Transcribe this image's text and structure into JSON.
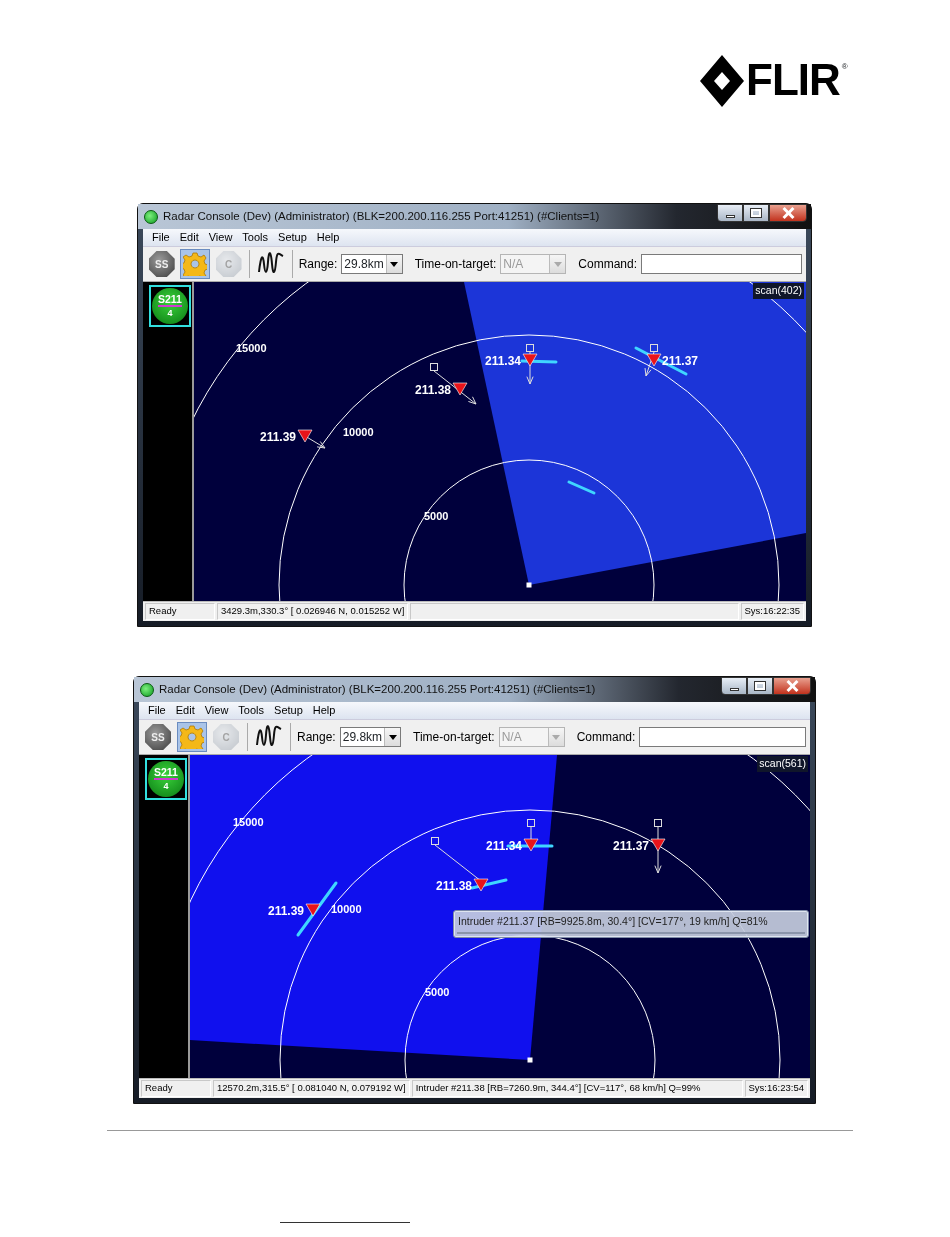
{
  "logo": {
    "text": "FLIR",
    "mark": "®"
  },
  "windows": [
    {
      "title": "Radar Console (Dev) (Administrator) (BLK=200.200.116.255 Port:41251) (#Clients=1)",
      "menu": [
        "File",
        "Edit",
        "View",
        "Tools",
        "Setup",
        "Help"
      ],
      "toolbar": {
        "buttons": [
          {
            "kind": "octagon",
            "label": "SS",
            "selected": false,
            "disabled": false
          },
          {
            "kind": "gear",
            "selected": true,
            "disabled": false
          },
          {
            "kind": "octagon",
            "label": "C",
            "selected": false,
            "disabled": true
          },
          {
            "kind": "wave",
            "selected": false,
            "disabled": false
          }
        ],
        "range": {
          "label": "Range:",
          "value": "29.8km"
        },
        "time_on_target": {
          "label": "Time-on-target:",
          "value": "N/A",
          "disabled": true
        },
        "command": {
          "label": "Command:"
        }
      },
      "sensors": [
        {
          "name": "S211",
          "count": "4",
          "selected": true
        }
      ],
      "radar": {
        "scan": "scan(402)",
        "rings": [
          "5000",
          "10000",
          "15000"
        ],
        "targets": [
          {
            "label": "211.34"
          },
          {
            "label": "211.37"
          },
          {
            "label": "211.38"
          },
          {
            "label": "211.39"
          }
        ]
      },
      "status_bar": {
        "state": "Ready",
        "position": "3429.3m,330.3° [ 0.026946 N,  0.015252 W]",
        "clock": "Sys:16:22:35"
      }
    },
    {
      "title": "Radar Console (Dev) (Administrator) (BLK=200.200.116.255 Port:41251) (#Clients=1)",
      "menu": [
        "File",
        "Edit",
        "View",
        "Tools",
        "Setup",
        "Help"
      ],
      "toolbar": {
        "buttons": [
          {
            "kind": "octagon",
            "label": "SS",
            "selected": false,
            "disabled": false
          },
          {
            "kind": "gear",
            "selected": true,
            "disabled": false
          },
          {
            "kind": "octagon",
            "label": "C",
            "selected": false,
            "disabled": true
          },
          {
            "kind": "wave",
            "selected": false,
            "disabled": false
          }
        ],
        "range": {
          "label": "Range:",
          "value": "29.8km"
        },
        "time_on_target": {
          "label": "Time-on-target:",
          "value": "N/A",
          "disabled": true
        },
        "command": {
          "label": "Command:"
        }
      },
      "sensors": [
        {
          "name": "S211",
          "count": "4",
          "selected": true
        }
      ],
      "radar": {
        "scan": "scan(561)",
        "rings": [
          "5000",
          "10000",
          "15000"
        ],
        "targets": [
          {
            "label": "211.34"
          },
          {
            "label": "211.37"
          },
          {
            "label": "211.38"
          },
          {
            "label": "211.39"
          }
        ],
        "tooltip": "Intruder #211.37 [RB=9925.8m, 30.4°] [CV=177°, 19 km/h] Q=81%"
      },
      "status_bar": {
        "state": "Ready",
        "position": "12570.2m,315.5° [ 0.081040 N,  0.079192 W]",
        "info": "Intruder #211.38 [RB=7260.9m, 344.4°] [CV=117°, 68 km/h] Q=99%",
        "clock": "Sys:16:23:54"
      }
    }
  ]
}
